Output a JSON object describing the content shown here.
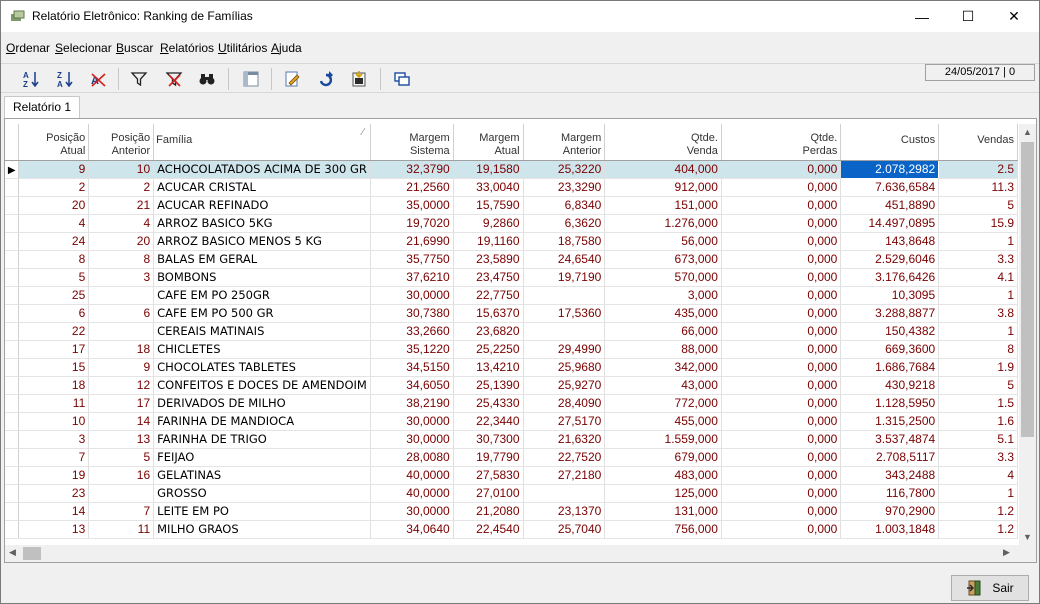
{
  "window": {
    "title": "Relatório Eletrônico: Ranking de Famílias",
    "min_glyph": "—",
    "max_glyph": "☐",
    "close_glyph": "✕"
  },
  "menu": [
    {
      "label": "Ordenar"
    },
    {
      "label": "Selecionar"
    },
    {
      "label": "Buscar"
    },
    {
      "label": "Relatórios"
    },
    {
      "label": "Utilitários"
    },
    {
      "label": "Ajuda"
    }
  ],
  "status_date": "24/05/2017 | 0",
  "toolbar_icons": [
    "sort-asc-icon",
    "sort-desc-icon",
    "clear-sort-icon",
    "filter-icon",
    "clear-filter-icon",
    "search-binoculars-icon",
    "report-layout-icon",
    "edit-icon",
    "refresh-icon",
    "export-icon",
    "windows-icon"
  ],
  "tab_label": "Relatório 1",
  "columns": [
    {
      "label1": "Posição",
      "label2": "Atual"
    },
    {
      "label1": "Posição",
      "label2": "Anterior"
    },
    {
      "label1": "Família",
      "label2": ""
    },
    {
      "label1": "Margem",
      "label2": "Sistema"
    },
    {
      "label1": "Margem",
      "label2": "Atual"
    },
    {
      "label1": "Margem",
      "label2": "Anterior"
    },
    {
      "label1": "Qtde.",
      "label2": "Venda"
    },
    {
      "label1": "Qtde.",
      "label2": "Perdas"
    },
    {
      "label1": "Custos",
      "label2": ""
    },
    {
      "label1": "Vendas",
      "label2": ""
    }
  ],
  "rows": [
    [
      "9",
      "10",
      "ACHOCOLATADOS ACIMA DE 300 GR",
      "32,3790",
      "19,1580",
      "25,3220",
      "404,000",
      "0,000",
      "2.078,2982",
      "2.5"
    ],
    [
      "2",
      "2",
      "ACUCAR CRISTAL",
      "21,2560",
      "33,0040",
      "23,3290",
      "912,000",
      "0,000",
      "7.636,6584",
      "11.3"
    ],
    [
      "20",
      "21",
      "ACUCAR REFINADO",
      "35,0000",
      "15,7590",
      "6,8340",
      "151,000",
      "0,000",
      "451,8890",
      "5"
    ],
    [
      "4",
      "4",
      "ARROZ BASICO 5KG",
      "19,7020",
      "9,2860",
      "6,3620",
      "1.276,000",
      "0,000",
      "14.497,0895",
      "15.9"
    ],
    [
      "24",
      "20",
      "ARROZ BASICO MENOS 5 KG",
      "21,6990",
      "19,1160",
      "18,7580",
      "56,000",
      "0,000",
      "143,8648",
      "1"
    ],
    [
      "8",
      "8",
      "BALAS EM GERAL",
      "35,7750",
      "23,5890",
      "24,6540",
      "673,000",
      "0,000",
      "2.529,6046",
      "3.3"
    ],
    [
      "5",
      "3",
      "BOMBONS",
      "37,6210",
      "23,4750",
      "19,7190",
      "570,000",
      "0,000",
      "3.176,6426",
      "4.1"
    ],
    [
      "25",
      "",
      "CAFE EM PO 250GR",
      "30,0000",
      "22,7750",
      "",
      "3,000",
      "0,000",
      "10,3095",
      "1"
    ],
    [
      "6",
      "6",
      "CAFE EM PO 500 GR",
      "30,7380",
      "15,6370",
      "17,5360",
      "435,000",
      "0,000",
      "3.288,8877",
      "3.8"
    ],
    [
      "22",
      "",
      "CEREAIS MATINAIS",
      "33,2660",
      "23,6820",
      "",
      "66,000",
      "0,000",
      "150,4382",
      "1"
    ],
    [
      "17",
      "18",
      "CHICLETES",
      "35,1220",
      "25,2250",
      "29,4990",
      "88,000",
      "0,000",
      "669,3600",
      "8"
    ],
    [
      "15",
      "9",
      "CHOCOLATES TABLETES",
      "34,5150",
      "13,4210",
      "25,9680",
      "342,000",
      "0,000",
      "1.686,7684",
      "1.9"
    ],
    [
      "18",
      "12",
      "CONFEITOS E DOCES DE AMENDOIM",
      "34,6050",
      "25,1390",
      "25,9270",
      "43,000",
      "0,000",
      "430,9218",
      "5"
    ],
    [
      "11",
      "17",
      "DERIVADOS DE MILHO",
      "38,2190",
      "25,4330",
      "28,4090",
      "772,000",
      "0,000",
      "1.128,5950",
      "1.5"
    ],
    [
      "10",
      "14",
      "FARINHA DE MANDIOCA",
      "30,0000",
      "22,3440",
      "27,5170",
      "455,000",
      "0,000",
      "1.315,2500",
      "1.6"
    ],
    [
      "3",
      "13",
      "FARINHA DE TRIGO",
      "30,0000",
      "30,7300",
      "21,6320",
      "1.559,000",
      "0,000",
      "3.537,4874",
      "5.1"
    ],
    [
      "7",
      "5",
      "FEIJAO",
      "28,0080",
      "19,7790",
      "22,7520",
      "679,000",
      "0,000",
      "2.708,5117",
      "3.3"
    ],
    [
      "19",
      "16",
      "GELATINAS",
      "40,0000",
      "27,5830",
      "27,2180",
      "483,000",
      "0,000",
      "343,2488",
      "4"
    ],
    [
      "23",
      "",
      "GROSSO",
      "40,0000",
      "27,0100",
      "",
      "125,000",
      "0,000",
      "116,7800",
      "1"
    ],
    [
      "14",
      "7",
      "LEITE EM PO",
      "30,0000",
      "21,2080",
      "23,1370",
      "131,000",
      "0,000",
      "970,2900",
      "1.2"
    ],
    [
      "13",
      "11",
      "MILHO GRAOS",
      "34,0640",
      "22,4540",
      "25,7040",
      "756,000",
      "0,000",
      "1.003,1848",
      "1.2"
    ]
  ],
  "sair_label": "Sair"
}
